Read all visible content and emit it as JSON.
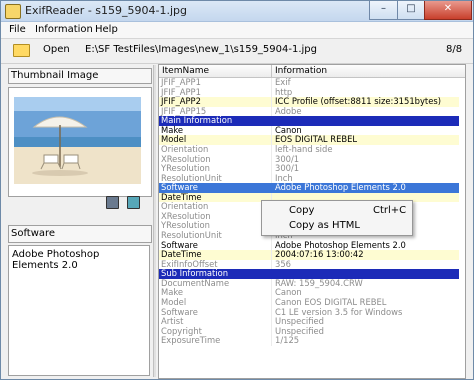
{
  "window": {
    "title": "ExifReader - s159_5904-1.jpg",
    "min_glyph": "–",
    "max_glyph": "□",
    "close_glyph": "✕"
  },
  "menu": [
    "File",
    "Information",
    "Help"
  ],
  "toolbar": {
    "open_label": "Open",
    "path": "E:\\SF TestFiles\\Images\\new_1\\s159_5904-1.jpg",
    "counter": "8/8"
  },
  "left": {
    "thumbnail_label": "Thumbnail Image",
    "software_label": "Software",
    "software_value": "Adobe Photoshop Elements 2.0"
  },
  "grid": {
    "columns": [
      "ItemName",
      "Information"
    ],
    "rows": [
      {
        "name": "JFIF_APP1",
        "info": "Exif",
        "style": "gray"
      },
      {
        "name": "JFIF_APP1",
        "info": "http",
        "style": "gray"
      },
      {
        "name": "JFIF_APP2",
        "info": "ICC Profile (offset:8811 size:3151bytes)",
        "style": "yellow"
      },
      {
        "name": "JFIF_APP15",
        "info": "Adobe",
        "style": "gray"
      },
      {
        "name": "Main Information",
        "info": "",
        "style": "section"
      },
      {
        "name": "Make",
        "info": "Canon",
        "style": "black"
      },
      {
        "name": "Model",
        "info": "EOS DIGITAL REBEL",
        "style": "yellow"
      },
      {
        "name": "Orientation",
        "info": "left-hand side",
        "style": "gray"
      },
      {
        "name": "XResolution",
        "info": "300/1",
        "style": "gray"
      },
      {
        "name": "YResolution",
        "info": "300/1",
        "style": "gray"
      },
      {
        "name": "ResolutionUnit",
        "info": "Inch",
        "style": "gray"
      },
      {
        "name": "Software",
        "info": "Adobe Photoshop Elements 2.0",
        "style": "selected"
      },
      {
        "name": "DateTime",
        "info": "",
        "style": "yellow"
      },
      {
        "name": "Orientation",
        "info": "",
        "style": "gray"
      },
      {
        "name": "XResolution",
        "info": "",
        "style": "gray"
      },
      {
        "name": "YResolution",
        "info": "",
        "style": "gray"
      },
      {
        "name": "ResolutionUnit",
        "info": "Inch",
        "style": "gray"
      },
      {
        "name": "Software",
        "info": "Adobe Photoshop Elements 2.0",
        "style": "black"
      },
      {
        "name": "DateTime",
        "info": "2004:07:16 13:00:42",
        "style": "yellow"
      },
      {
        "name": "ExifInfoOffset",
        "info": "356",
        "style": "gray"
      },
      {
        "name": "Sub Information",
        "info": "",
        "style": "section"
      },
      {
        "name": "DocumentName",
        "info": "RAW: 159_5904.CRW",
        "style": "gray"
      },
      {
        "name": "Make",
        "info": "Canon",
        "style": "gray"
      },
      {
        "name": "Model",
        "info": "Canon EOS DIGITAL REBEL",
        "style": "gray"
      },
      {
        "name": "Software",
        "info": "C1 LE version 3.5 for Windows",
        "style": "gray"
      },
      {
        "name": "Artist",
        "info": "Unspecified",
        "style": "gray"
      },
      {
        "name": "Copyright",
        "info": "Unspecified",
        "style": "gray"
      },
      {
        "name": "ExposureTime",
        "info": "1/125",
        "style": "gray"
      }
    ]
  },
  "context_menu": {
    "items": [
      {
        "label": "Copy",
        "shortcut": "Ctrl+C"
      },
      {
        "label": "Copy as HTML",
        "shortcut": ""
      }
    ]
  },
  "colors": {
    "section": "#1c2bb8",
    "selected": "#3b76d8",
    "highlight": "#fefcd2"
  }
}
